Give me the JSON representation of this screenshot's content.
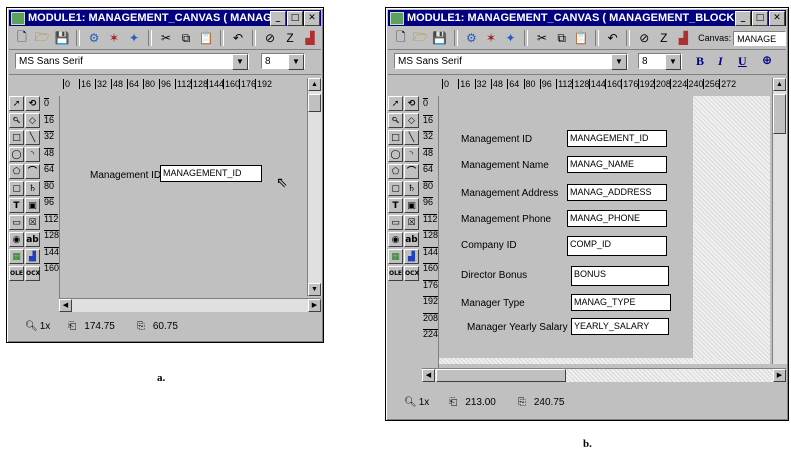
{
  "window_a": {
    "title": "MODULE1: MANAGEMENT_CANVAS ( MANAG...",
    "font_name": "MS Sans Serif",
    "font_size": "8",
    "ruler_ticks": [
      "0",
      "16",
      "32",
      "48",
      "64",
      "80",
      "96",
      "112",
      "128",
      "144",
      "160",
      "176",
      "192"
    ],
    "vruler_ticks": [
      "0",
      "16",
      "32",
      "48",
      "64",
      "80",
      "96",
      "112",
      "128",
      "144",
      "160"
    ],
    "field_label": "Management ID",
    "field_value": "MANAGEMENT_ID",
    "status_zoom": "1x",
    "status_x": "174.75",
    "status_y": "60.75"
  },
  "window_b": {
    "title": "MODULE1: MANAGEMENT_CANVAS ( MANAGEMENT_BLOCK )",
    "canvas_label": "Canvas:",
    "canvas_value": "MANAGE",
    "font_name": "MS Sans Serif",
    "font_size": "8",
    "ruler_ticks": [
      "0",
      "16",
      "32",
      "48",
      "64",
      "80",
      "96",
      "112",
      "128",
      "144",
      "160",
      "176",
      "192",
      "208",
      "224",
      "240",
      "256",
      "272"
    ],
    "vruler_ticks": [
      "0",
      "16",
      "32",
      "48",
      "64",
      "80",
      "96",
      "112",
      "128",
      "144",
      "160",
      "176",
      "192",
      "208",
      "224"
    ],
    "fields": [
      {
        "label": "Management ID",
        "value": "MANAGEMENT_ID"
      },
      {
        "label": "Management Name",
        "value": "MANAG_NAME"
      },
      {
        "label": "Management Address",
        "value": "MANAG_ADDRESS"
      },
      {
        "label": "Management Phone",
        "value": "MANAG_PHONE"
      },
      {
        "label": "Company ID",
        "value": "COMP_ID"
      },
      {
        "label": "Director Bonus",
        "value": "BONUS"
      },
      {
        "label": "Manager Type",
        "value": "MANAG_TYPE"
      },
      {
        "label": "Manager Yearly Salary",
        "value": "YEARLY_SALARY"
      }
    ],
    "status_zoom": "1x",
    "status_x": "213.00",
    "status_y": "240.75"
  },
  "captions": {
    "a": "a.",
    "b": "b."
  },
  "icons": {
    "palette": [
      "arrow-icon",
      "rotate-icon",
      "magnify-icon",
      "reshape-icon",
      "rectangle-icon",
      "line-icon",
      "ellipse-icon",
      "arc-icon",
      "polygon-icon",
      "polyline-icon",
      "rounded-rect-icon",
      "freehand-icon",
      "text-icon",
      "frame-icon",
      "button-icon",
      "checkbox-icon",
      "radio-icon",
      "textitem-icon",
      "image-icon",
      "chart-icon",
      "ole-icon",
      "ocx-icon"
    ]
  }
}
